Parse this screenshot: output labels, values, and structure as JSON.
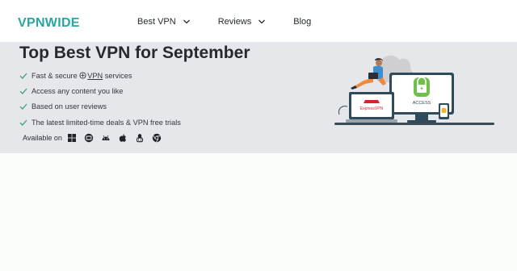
{
  "header": {
    "logo": "VPNWIDE",
    "nav": [
      {
        "label": "Best VPN",
        "has_dropdown": true
      },
      {
        "label": "Reviews",
        "has_dropdown": true
      },
      {
        "label": "Blog",
        "has_dropdown": false
      }
    ]
  },
  "hero": {
    "title": "Top Best VPN for September",
    "features": {
      "f1_before": "Fast & secure",
      "f1_link": "VPN",
      "f1_after": "services",
      "f2": "Access any content you like",
      "f3": "Based on user reviews",
      "f4": "The latest limited-time deals & VPN free trials"
    },
    "available_label": "Available on",
    "platform_icons": [
      "windows-icon",
      "macos-icon",
      "android-icon",
      "apple-icon",
      "linux-icon",
      "chrome-icon"
    ]
  },
  "illustration": {
    "laptop_brand": "ExpressVPN",
    "monitor_brand": "ACCESS"
  },
  "colors": {
    "accent": "#27a7a0",
    "check": "#3aa27a",
    "hero_bg": "#e6e7eb",
    "page_bg": "#fbfdfb"
  }
}
